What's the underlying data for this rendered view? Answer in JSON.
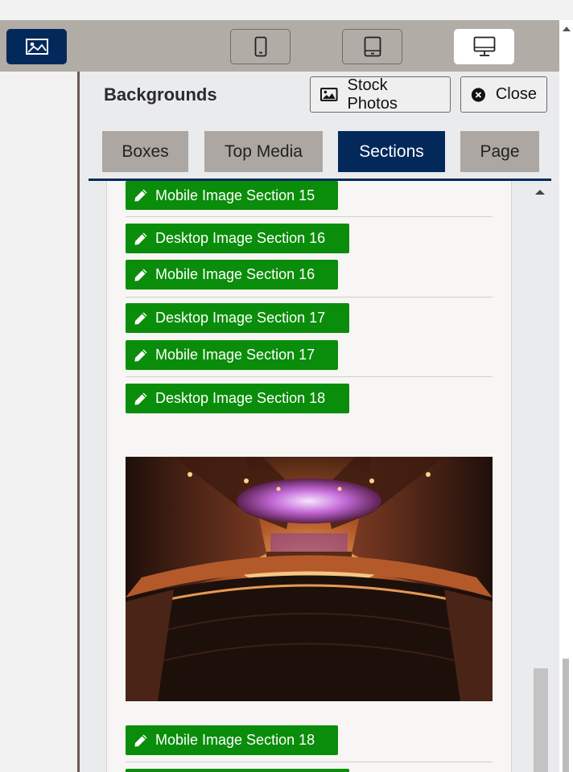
{
  "toolbar": {
    "media_button": {
      "icon": "image-icon"
    },
    "devices": [
      {
        "name": "mobile",
        "icon": "mobile-phone-icon",
        "active": false
      },
      {
        "name": "tablet",
        "icon": "tablet-icon",
        "active": false
      },
      {
        "name": "desktop",
        "icon": "desktop-monitor-icon",
        "active": true
      }
    ]
  },
  "panel": {
    "title": "Backgrounds",
    "stock_photos_label": "Stock Photos",
    "close_label": "Close",
    "tabs": [
      {
        "label": "Boxes",
        "active": false
      },
      {
        "label": "Top Media",
        "active": false
      },
      {
        "label": "Sections",
        "active": true
      },
      {
        "label": "Page",
        "active": false
      }
    ]
  },
  "sections": {
    "buttons": [
      "Mobile Image Section 15",
      "Desktop Image Section 16",
      "Mobile Image Section 16",
      "Desktop Image Section 17",
      "Mobile Image Section 17",
      "Desktop Image Section 18",
      "Mobile Image Section 18"
    ]
  },
  "colors": {
    "accent_navy": "#03295b",
    "button_green": "#0a8d0a",
    "toolbar_gray": "#b1aca6",
    "tab_gray": "#aca7a2"
  }
}
